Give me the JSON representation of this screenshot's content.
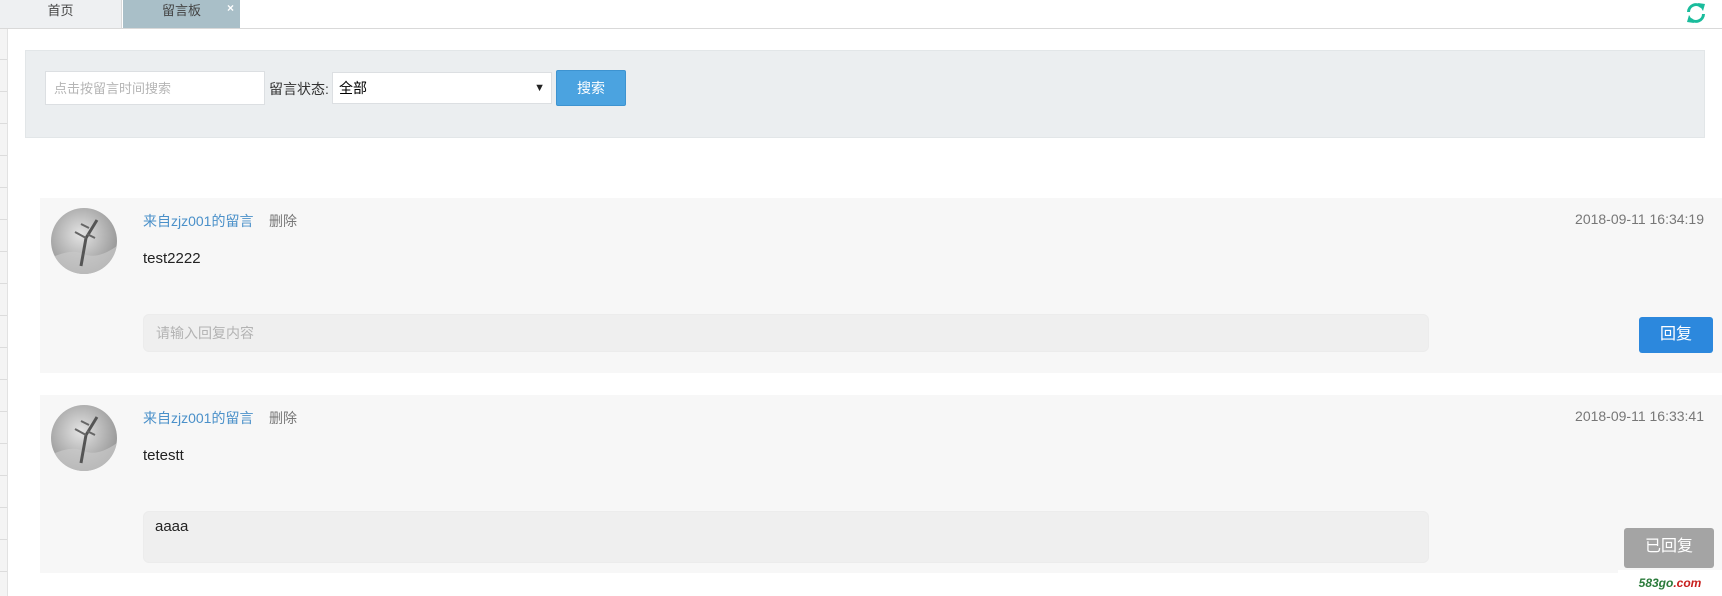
{
  "tabs": [
    {
      "label": "首页"
    },
    {
      "label": "留言板",
      "close": "×"
    }
  ],
  "toolbar": {
    "refresh_icon": "refresh-icon",
    "accent": "#1abc9c"
  },
  "search": {
    "date_placeholder": "点击按留言时间搜索",
    "status_label": "留言状态:",
    "status_selected": "全部",
    "button_label": "搜索"
  },
  "messages": [
    {
      "from": "来自zjz001的留言",
      "delete_label": "删除",
      "time": "2018-09-11 16:34:19",
      "content": "test2222",
      "reply_placeholder": "请输入回复内容",
      "reply_button": "回复"
    },
    {
      "from": "来自zjz001的留言",
      "delete_label": "删除",
      "time": "2018-09-11 16:33:41",
      "content": "tetestt",
      "reply_text": "aaaa",
      "replied_button": "已回复"
    }
  ],
  "watermark": {
    "part1": "583go",
    "part2": ".com"
  },
  "colors": {
    "link": "#4a90c9",
    "primary": "#2c88dd",
    "search_btn": "#4ba3e0",
    "replied": "#a4a4a4"
  }
}
